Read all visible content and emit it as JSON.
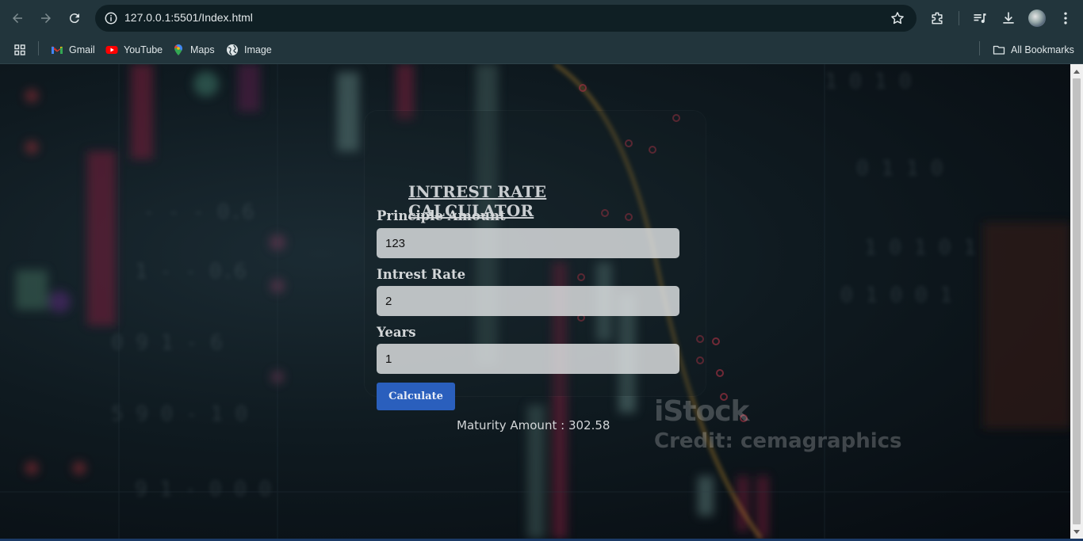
{
  "browser": {
    "url": "127.0.0.1:5501/Index.html",
    "bookmarks": [
      {
        "label": "Gmail",
        "icon": "gmail-icon"
      },
      {
        "label": "YouTube",
        "icon": "youtube-icon"
      },
      {
        "label": "Maps",
        "icon": "maps-icon"
      },
      {
        "label": "Image",
        "icon": "globe-icon"
      }
    ],
    "all_bookmarks_label": "All Bookmarks"
  },
  "page": {
    "title": "INTREST RATE CALCULATOR",
    "fields": [
      {
        "label": "Principle Amount",
        "value": "123"
      },
      {
        "label": "Intrest Rate",
        "value": "2"
      },
      {
        "label": "Years",
        "value": "1"
      }
    ],
    "calculate_label": "Calculate",
    "result_label": "Maturity Amount :",
    "result_value": "302.58",
    "watermark_brand": "iStock",
    "watermark_credit": "Credit: cemagraphics"
  },
  "colors": {
    "chrome_bg": "#22353c",
    "button": "#2a5fbd",
    "page_bg": "#0f1a20"
  }
}
